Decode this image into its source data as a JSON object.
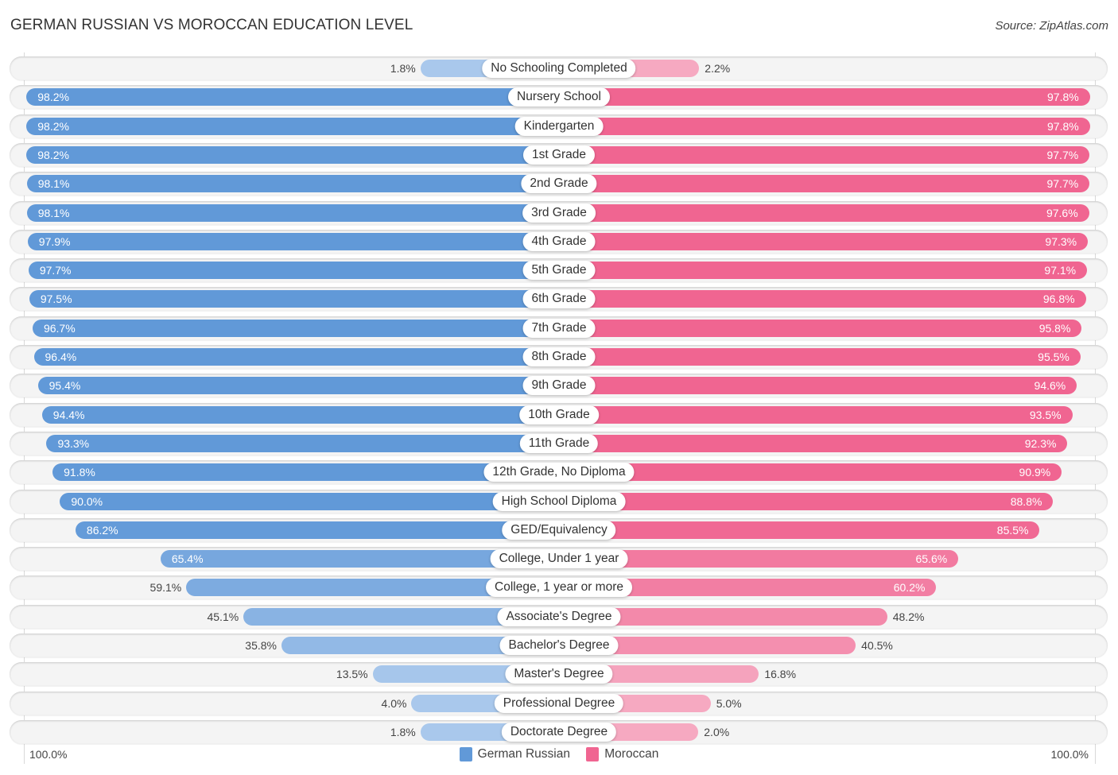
{
  "header": {
    "title": "GERMAN RUSSIAN VS MOROCCAN EDUCATION LEVEL",
    "source": "Source: ZipAtlas.com"
  },
  "colors": {
    "german_russian": "#6199d8",
    "german_russian_light": "#a9c8ec",
    "moroccan": "#f06591",
    "moroccan_light": "#f6a9c1"
  },
  "axis": {
    "left_label": "100.0%",
    "right_label": "100.0%"
  },
  "legend": {
    "items": [
      {
        "label": "German Russian",
        "color": "#6199d8"
      },
      {
        "label": "Moroccan",
        "color": "#f06591"
      }
    ]
  },
  "chart_data": {
    "type": "bar",
    "orientation": "horizontal-diverging",
    "title": "GERMAN RUSSIAN VS MOROCCAN EDUCATION LEVEL",
    "source": "Source: ZipAtlas.com",
    "xlabel": "",
    "ylabel": "",
    "xlim": [
      0,
      100
    ],
    "unit": "%",
    "legend_position": "bottom-center",
    "categories": [
      "No Schooling Completed",
      "Nursery School",
      "Kindergarten",
      "1st Grade",
      "2nd Grade",
      "3rd Grade",
      "4th Grade",
      "5th Grade",
      "6th Grade",
      "7th Grade",
      "8th Grade",
      "9th Grade",
      "10th Grade",
      "11th Grade",
      "12th Grade, No Diploma",
      "High School Diploma",
      "GED/Equivalency",
      "College, Under 1 year",
      "College, 1 year or more",
      "Associate's Degree",
      "Bachelor's Degree",
      "Master's Degree",
      "Professional Degree",
      "Doctorate Degree"
    ],
    "series": [
      {
        "name": "German Russian",
        "side": "left",
        "values": [
          1.8,
          98.2,
          98.2,
          98.2,
          98.1,
          98.1,
          97.9,
          97.7,
          97.5,
          96.7,
          96.4,
          95.4,
          94.4,
          93.3,
          91.8,
          90.0,
          86.2,
          65.4,
          59.1,
          45.1,
          35.8,
          13.5,
          4.0,
          1.8
        ],
        "labels": [
          "1.8%",
          "98.2%",
          "98.2%",
          "98.2%",
          "98.1%",
          "98.1%",
          "97.9%",
          "97.7%",
          "97.5%",
          "96.7%",
          "96.4%",
          "95.4%",
          "94.4%",
          "93.3%",
          "91.8%",
          "90.0%",
          "86.2%",
          "65.4%",
          "59.1%",
          "45.1%",
          "35.8%",
          "13.5%",
          "4.0%",
          "1.8%"
        ]
      },
      {
        "name": "Moroccan",
        "side": "right",
        "values": [
          2.2,
          97.8,
          97.8,
          97.7,
          97.7,
          97.6,
          97.3,
          97.1,
          96.8,
          95.8,
          95.5,
          94.6,
          93.5,
          92.3,
          90.9,
          88.8,
          85.5,
          65.6,
          60.2,
          48.2,
          40.5,
          16.8,
          5.0,
          2.0
        ],
        "labels": [
          "2.2%",
          "97.8%",
          "97.8%",
          "97.7%",
          "97.7%",
          "97.6%",
          "97.3%",
          "97.1%",
          "96.8%",
          "95.8%",
          "95.5%",
          "94.6%",
          "93.5%",
          "92.3%",
          "90.9%",
          "88.8%",
          "85.5%",
          "65.6%",
          "60.2%",
          "48.2%",
          "40.5%",
          "16.8%",
          "5.0%",
          "2.0%"
        ]
      }
    ]
  }
}
